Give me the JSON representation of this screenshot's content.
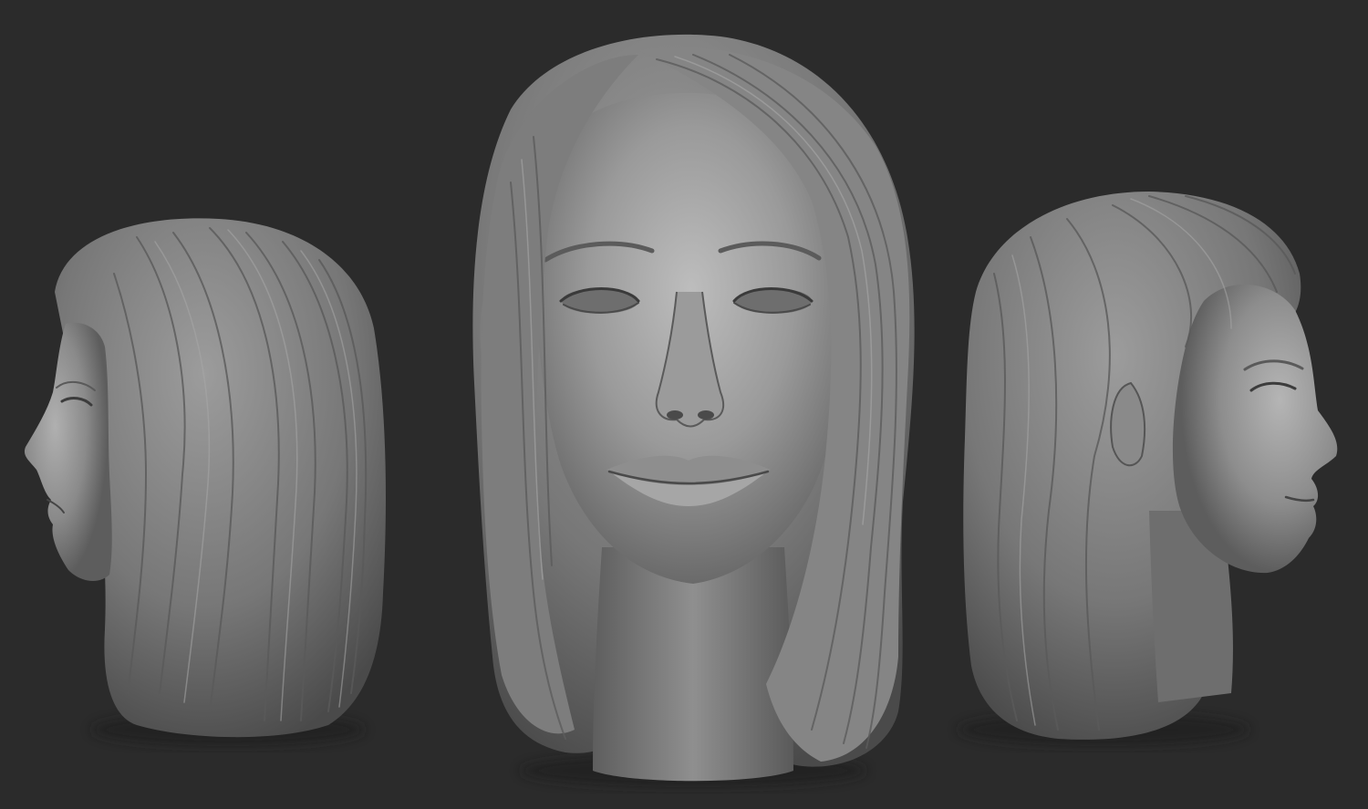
{
  "scene": {
    "subject": "sculpted-female-head-three-views",
    "views": [
      {
        "id": "left-profile",
        "facing": "left"
      },
      {
        "id": "front",
        "facing": "viewer"
      },
      {
        "id": "right-three-quarter",
        "facing": "right"
      }
    ],
    "colors": {
      "background": "#2b2b2b",
      "clay_light": "#b9b9b9",
      "clay_mid": "#8a8a8a",
      "clay_dark": "#4a4a4a",
      "shadow": "#1f1f1f"
    }
  }
}
